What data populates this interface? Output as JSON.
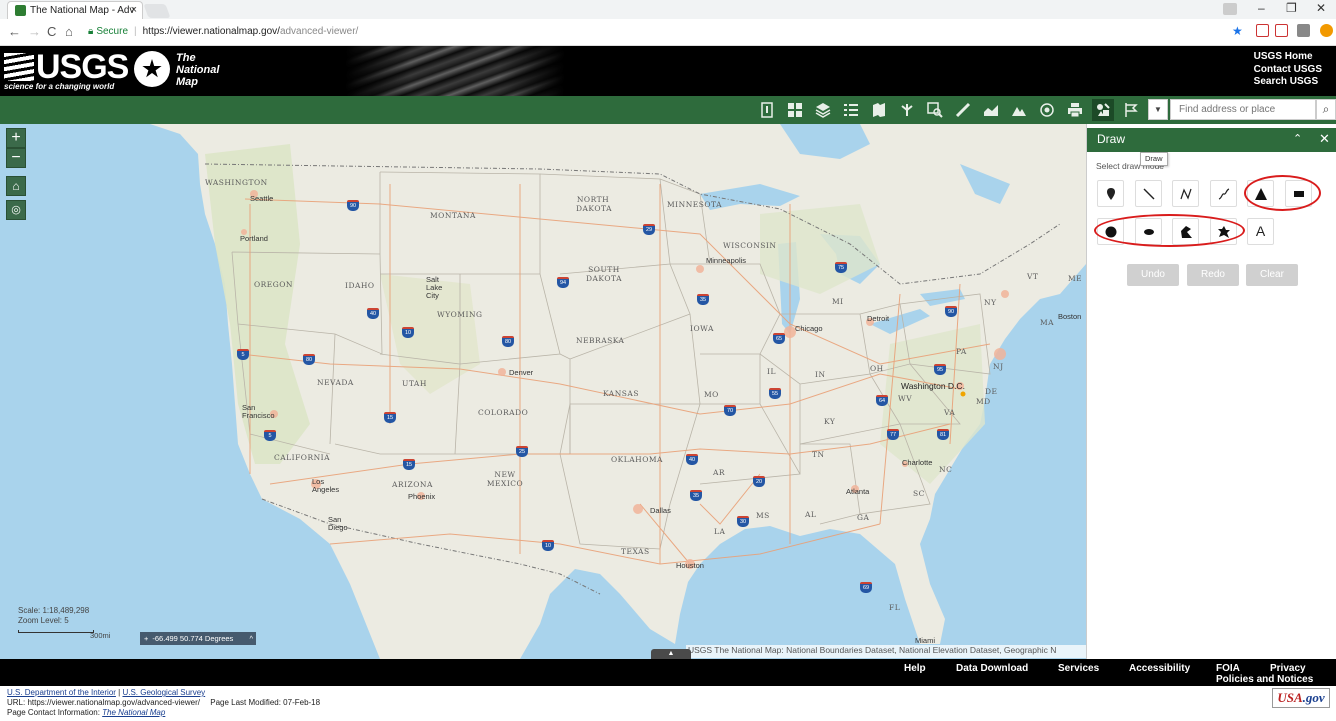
{
  "browser": {
    "tab_title": "The National Map - Adv",
    "tab_close": "×",
    "nav": {
      "back": "←",
      "forward": "→",
      "reload": "C",
      "home": "⌂"
    },
    "secure_label": "Secure",
    "url_host": "https://viewer.nationalmap.gov/",
    "url_path": "advanced-viewer/",
    "window_controls": {
      "minimize": "–",
      "restore": "❐",
      "close": "✕"
    }
  },
  "header": {
    "usgs_logo": "USGS",
    "usgs_tagline": "science for a changing world",
    "tnm_line1": "The",
    "tnm_line2": "National",
    "tnm_line3": "Map",
    "links": [
      "USGS Home",
      "Contact USGS",
      "Search USGS"
    ]
  },
  "toolbar": {
    "search_placeholder": "Find address or place",
    "search_dropdown": "▼",
    "search_icon": "⌕",
    "icons": [
      "info-icon",
      "basemap-grid-icon",
      "layers-icon",
      "legend-list-icon",
      "bookmark-icon",
      "directions-icon",
      "query-icon",
      "measure-icon",
      "elevation-profile-icon",
      "terrain-icon",
      "location-icon",
      "print-icon",
      "draw-icon",
      "coordinates-icon"
    ]
  },
  "map": {
    "zoom_in": "+",
    "zoom_out": "−",
    "scale_text": "Scale: 1:18,489,298",
    "zoom_level_text": "Zoom Level: 5",
    "scale_unit": "300mi",
    "coordinates": "-66.499 50.774 Degrees",
    "attribution": "USGS The National Map: National Boundaries Dataset, National Elevation Dataset, Geographic N",
    "collapse_arrow": "▲",
    "state_labels": [
      "WASHINGTON",
      "OREGON",
      "IDAHO",
      "MONTANA",
      "WYOMING",
      "NEVADA",
      "UTAH",
      "COLORADO",
      "CALIFORNIA",
      "ARIZONA",
      "NEW MEXICO",
      "NORTH DAKOTA",
      "SOUTH DAKOTA",
      "NEBRASKA",
      "KANSAS",
      "OKLAHOMA",
      "TEXAS",
      "MINNESOTA",
      "IOWA",
      "MO",
      "AR",
      "LA",
      "WISCONSIN",
      "MI",
      "IL",
      "IN",
      "OH",
      "KY",
      "TN",
      "MS",
      "AL",
      "GA",
      "FL",
      "SC",
      "NC",
      "VA",
      "WV",
      "PA",
      "NY",
      "VT",
      "ME",
      "MA",
      "DE",
      "MD",
      "NJ"
    ],
    "city_labels": [
      "Seattle",
      "Portland",
      "Minneapolis",
      "Chicago",
      "Detroit",
      "Denver",
      "Phoenix",
      "San Francisco",
      "Los Angeles",
      "San Diego",
      "Dallas",
      "Houston",
      "Atlanta",
      "Washington D.C.",
      "Boston",
      "Miami",
      "Charlotte",
      "Salt Lake City"
    ],
    "highways": [
      "90",
      "94",
      "29",
      "90",
      "35",
      "80",
      "80",
      "15",
      "70",
      "25",
      "40",
      "35",
      "30",
      "20",
      "10",
      "5",
      "5",
      "15",
      "55",
      "65",
      "75",
      "95",
      "81",
      "64",
      "77",
      "40",
      "10",
      "69"
    ]
  },
  "draw_panel": {
    "title": "Draw",
    "tooltip": "Draw",
    "subtitle": "Select draw mode",
    "collapse_icon": "⌃",
    "close_icon": "✕",
    "modes_row1": [
      "point",
      "line",
      "polyline",
      "freehand-polyline",
      "triangle",
      "rectangle"
    ],
    "modes_row2": [
      "circle",
      "ellipse",
      "polygon",
      "freehand-polygon",
      "text"
    ],
    "text_mode_label": "A",
    "buttons": [
      "Undo",
      "Redo",
      "Clear"
    ]
  },
  "footer": {
    "links": [
      "Help",
      "Data Download",
      "Services",
      "Accessibility"
    ],
    "foia_line1": "FOIA",
    "foia_line2": "Policies and Notices",
    "privacy_label": "Privacy"
  },
  "bottom": {
    "doi": "U.S. Department of the Interior",
    "sep": " | ",
    "usgs": "U.S. Geological Survey",
    "url_line": "URL: https://viewer.nationalmap.gov/advanced-viewer/",
    "modified": "Page Last Modified: 07-Feb-18",
    "contact_prefix": "Page Contact Information: ",
    "contact_link": "The National Map",
    "usagov_a": "USA",
    "usagov_b": ".gov"
  },
  "colors": {
    "usgs_green": "#2e6b3c",
    "header_black": "#000000",
    "annotation_red": "#d91c1c",
    "water": "#a9d3ec",
    "land": "#ecebe2"
  }
}
